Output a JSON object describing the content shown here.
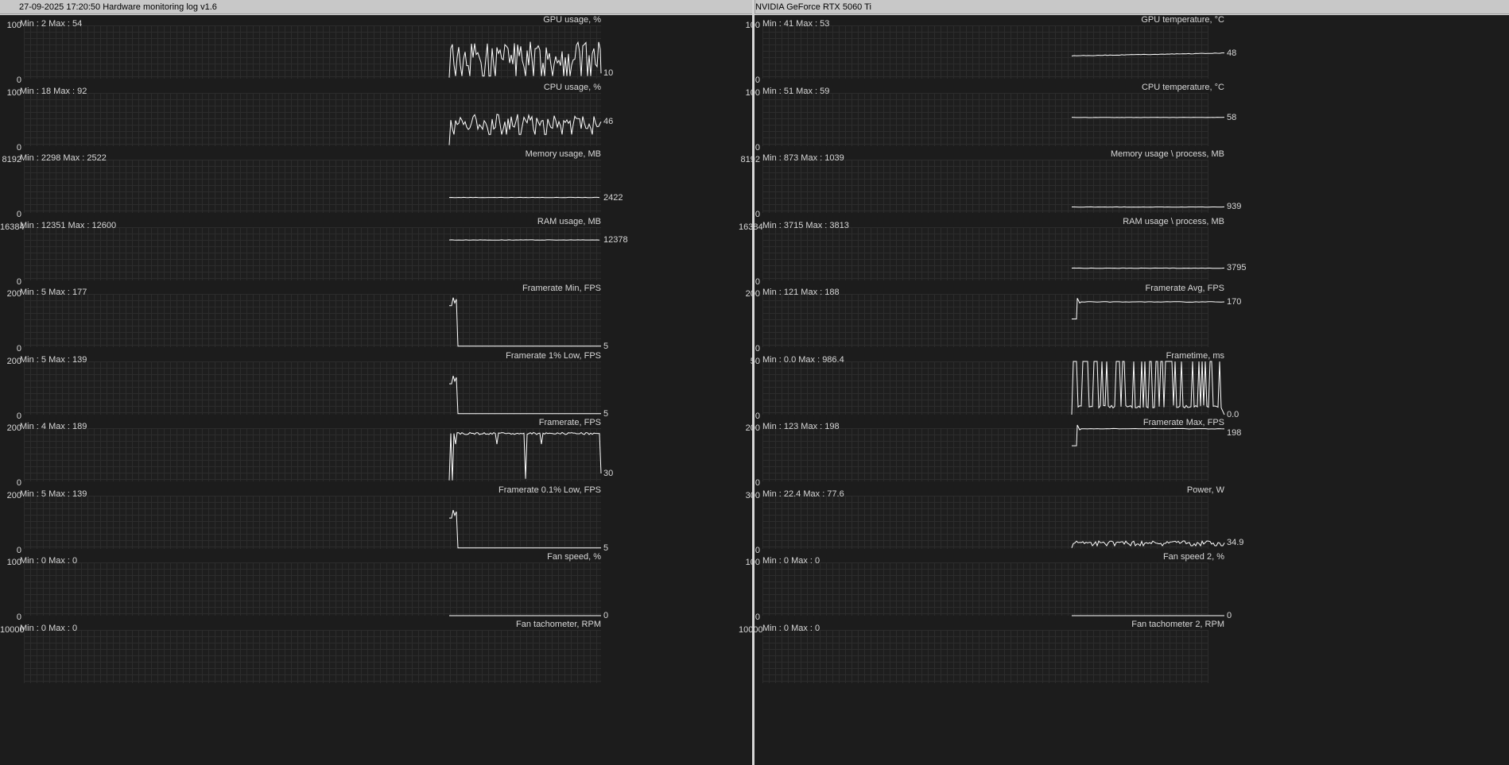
{
  "header": {
    "left_title": "27-09-2025 17:20:50 Hardware monitoring log v1.6",
    "right_title": "NVIDIA GeForce RTX 5060 Ti"
  },
  "left_graphs": [
    {
      "name": "gpu-usage",
      "title": "GPU usage, %",
      "minmax": "Min : 2   Max : 54",
      "ymax": "100",
      "ymin": "0",
      "current": "10",
      "kind": "noisy",
      "level": 0.45,
      "amp": 0.25,
      "range": [
        0,
        100
      ],
      "value": 10
    },
    {
      "name": "cpu-usage",
      "title": "CPU usage, %",
      "minmax": "Min : 18   Max : 92",
      "ymax": "100",
      "ymin": "0",
      "current": "46",
      "kind": "noisy",
      "level": 0.46,
      "amp": 0.15,
      "range": [
        0,
        100
      ],
      "value": 46
    },
    {
      "name": "memory-usage",
      "title": "Memory usage, MB",
      "minmax": "Min : 2298   Max : 2522",
      "ymax": "8192",
      "ymin": "0",
      "current": "2422",
      "kind": "flat",
      "level": 0.29,
      "range": [
        0,
        8192
      ],
      "value": 2422
    },
    {
      "name": "ram-usage",
      "title": "RAM usage, MB",
      "minmax": "Min : 12351   Max : 12600",
      "ymax": "16384",
      "ymin": "0",
      "current": "12378",
      "kind": "flat",
      "level": 0.76,
      "range": [
        0,
        16384
      ],
      "value": 12378
    },
    {
      "name": "framerate-min",
      "title": "Framerate Min, FPS",
      "minmax": "Min : 5   Max : 177",
      "ymax": "200",
      "ymin": "0",
      "current": "5",
      "kind": "dropoff",
      "level": 0.88,
      "range": [
        0,
        200
      ],
      "value": 5
    },
    {
      "name": "framerate-1-low",
      "title": "Framerate 1% Low, FPS",
      "minmax": "Min : 5   Max : 139",
      "ymax": "200",
      "ymin": "0",
      "current": "5",
      "kind": "dropoff",
      "level": 0.68,
      "range": [
        0,
        200
      ],
      "value": 5
    },
    {
      "name": "framerate",
      "title": "Framerate, FPS",
      "minmax": "Min : 4   Max : 189",
      "ymax": "200",
      "ymin": "0",
      "current": "30",
      "kind": "spiky-high",
      "level": 0.9,
      "range": [
        0,
        200
      ],
      "value": 30
    },
    {
      "name": "framerate-01-low",
      "title": "Framerate 0.1% Low, FPS",
      "minmax": "Min : 5   Max : 139",
      "ymax": "200",
      "ymin": "0",
      "current": "5",
      "kind": "dropoff",
      "level": 0.68,
      "range": [
        0,
        200
      ],
      "value": 5
    },
    {
      "name": "fan-speed",
      "title": "Fan speed, %",
      "minmax": "Min : 0   Max : 0",
      "ymax": "100",
      "ymin": "0",
      "current": "0",
      "kind": "zero",
      "level": 0.0,
      "range": [
        0,
        100
      ],
      "value": 0
    },
    {
      "name": "fan-tachometer",
      "title": "Fan tachometer, RPM",
      "minmax": "Min : 0   Max : 0",
      "ymax": "10000",
      "ymin": "",
      "current": "",
      "kind": "none",
      "level": 0.0,
      "range": [
        0,
        10000
      ],
      "value": 0
    }
  ],
  "right_graphs": [
    {
      "name": "gpu-temperature",
      "title": "GPU temperature, °C",
      "minmax": "Min : 41   Max : 53",
      "ymax": "100",
      "ymin": "0",
      "current": "48",
      "kind": "rising",
      "level": 0.48,
      "range": [
        0,
        100
      ],
      "value": 48
    },
    {
      "name": "cpu-temperature",
      "title": "CPU temperature, °C",
      "minmax": "Min : 51   Max : 59",
      "ymax": "100",
      "ymin": "0",
      "current": "58",
      "kind": "flat",
      "level": 0.54,
      "range": [
        0,
        100
      ],
      "value": 58
    },
    {
      "name": "memory-usage-process",
      "title": "Memory usage \\ process, MB",
      "minmax": "Min : 873   Max : 1039",
      "ymax": "8192",
      "ymin": "0",
      "current": "939",
      "kind": "flat",
      "level": 0.11,
      "range": [
        0,
        8192
      ],
      "value": 939
    },
    {
      "name": "ram-usage-process",
      "title": "RAM usage \\ process, MB",
      "minmax": "Min : 3715   Max : 3813",
      "ymax": "16384",
      "ymin": "0",
      "current": "3795",
      "kind": "flat",
      "level": 0.23,
      "range": [
        0,
        16384
      ],
      "value": 3795
    },
    {
      "name": "framerate-avg",
      "title": "Framerate Avg, FPS",
      "minmax": "Min : 121   Max : 188",
      "ymax": "200",
      "ymin": "0",
      "current": "170",
      "kind": "step-up",
      "level": 0.85,
      "range": [
        0,
        200
      ],
      "value": 170
    },
    {
      "name": "frametime",
      "title": "Frametime, ms",
      "minmax": "Min : 0.0   Max : 986.4",
      "ymax": "50",
      "ymin": "0",
      "current": "0.0",
      "kind": "frametime",
      "level": 0.15,
      "range": [
        0,
        50
      ],
      "value": 0.0
    },
    {
      "name": "framerate-max",
      "title": "Framerate Max, FPS",
      "minmax": "Min : 123   Max : 198",
      "ymax": "200",
      "ymin": "0",
      "current": "198",
      "kind": "step-up",
      "level": 0.99,
      "range": [
        0,
        200
      ],
      "value": 198
    },
    {
      "name": "power",
      "title": "Power, W",
      "minmax": "Min : 22.4   Max : 77.6",
      "ymax": "300",
      "ymin": "0",
      "current": "34.9",
      "kind": "noisy-low",
      "level": 0.12,
      "amp": 0.03,
      "range": [
        0,
        300
      ],
      "value": 34.9
    },
    {
      "name": "fan-speed-2",
      "title": "Fan speed 2, %",
      "minmax": "Min : 0   Max : 0",
      "ymax": "100",
      "ymin": "0",
      "current": "0",
      "kind": "zero",
      "level": 0.0,
      "range": [
        0,
        100
      ],
      "value": 0
    },
    {
      "name": "fan-tachometer-2",
      "title": "Fan tachometer 2, RPM",
      "minmax": "Min : 0   Max : 0",
      "ymax": "10000",
      "ymin": "",
      "current": "",
      "kind": "none",
      "level": 0.0,
      "range": [
        0,
        10000
      ],
      "value": 0
    }
  ],
  "colors": {
    "background": "#1c1c1c",
    "grid": "#2c2c2c",
    "trace": "#ffffff",
    "text": "#d8d8d8",
    "titlebar": "#c8c8c8"
  }
}
